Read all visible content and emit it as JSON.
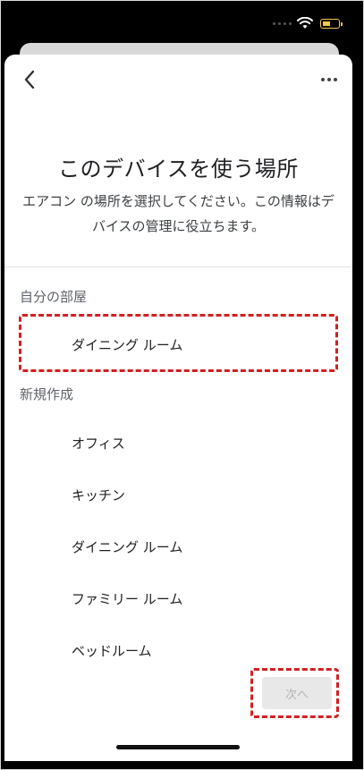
{
  "header": {
    "title": "このデバイスを使う場所",
    "subtitle": "エアコン の場所を選択してください。この情報はデバイスの管理に役立ちます。"
  },
  "sections": {
    "my_rooms": {
      "label": "自分の部屋",
      "items": [
        "ダイニング ルーム"
      ]
    },
    "create_new": {
      "label": "新規作成",
      "items": [
        "オフィス",
        "キッチン",
        "ダイニング ルーム",
        "ファミリー ルーム",
        "ベッドルーム"
      ]
    }
  },
  "footer": {
    "next_label": "次へ"
  },
  "colors": {
    "highlight": "#d32020",
    "battery": "#f2c94c"
  }
}
